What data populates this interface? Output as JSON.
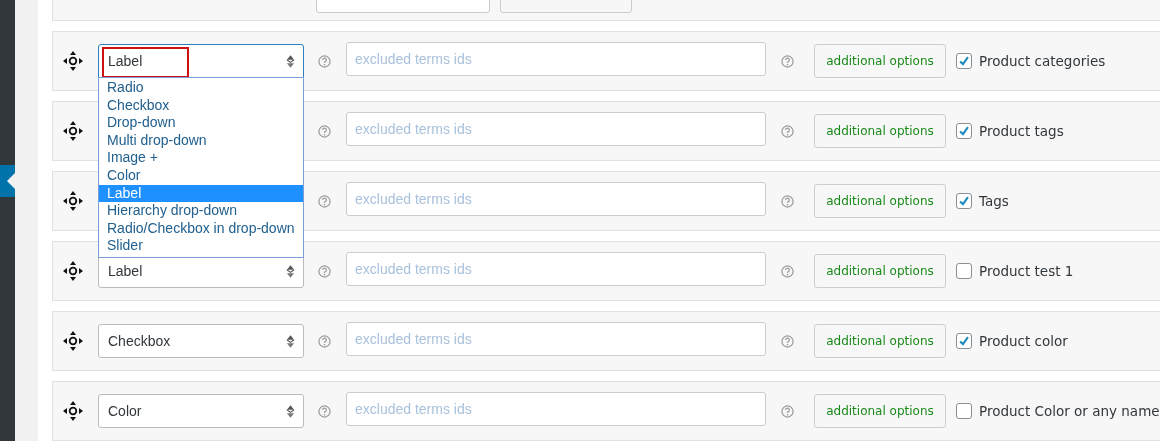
{
  "rows": [
    {
      "type": "Label",
      "open": true,
      "annotated": true,
      "placeholder": "excluded terms ids",
      "button": "additional options",
      "checked": true,
      "label": "Product categories",
      "options": [
        {
          "text": "Radio",
          "selected": false
        },
        {
          "text": "Checkbox",
          "selected": false
        },
        {
          "text": "Drop-down",
          "selected": false
        },
        {
          "text": "Multi drop-down",
          "selected": false
        },
        {
          "text": "Image +",
          "selected": false
        },
        {
          "text": "Color",
          "selected": false
        },
        {
          "text": "Label",
          "selected": true
        },
        {
          "text": "Hierarchy drop-down",
          "selected": false
        },
        {
          "text": "Radio/Checkbox in drop-down",
          "selected": false
        },
        {
          "text": "Slider",
          "selected": false
        }
      ]
    },
    {
      "annotated": false,
      "placeholder": "excluded terms ids",
      "button": "additional options",
      "checked": true,
      "label": "Product tags"
    },
    {
      "annotated": false,
      "placeholder": "excluded terms ids",
      "button": "additional options",
      "checked": true,
      "label": "Tags"
    },
    {
      "type": "Label",
      "open": false,
      "annotated": false,
      "placeholder": "excluded terms ids",
      "button": "additional options",
      "checked": false,
      "label": "Product test 1"
    },
    {
      "type": "Checkbox",
      "open": false,
      "annotated": false,
      "placeholder": "excluded terms ids",
      "button": "additional options",
      "checked": true,
      "label": "Product color"
    },
    {
      "type": "Color",
      "open": false,
      "annotated": false,
      "placeholder": "excluded terms ids",
      "button": "additional options",
      "checked": false,
      "label": "Product Color or any name"
    }
  ]
}
